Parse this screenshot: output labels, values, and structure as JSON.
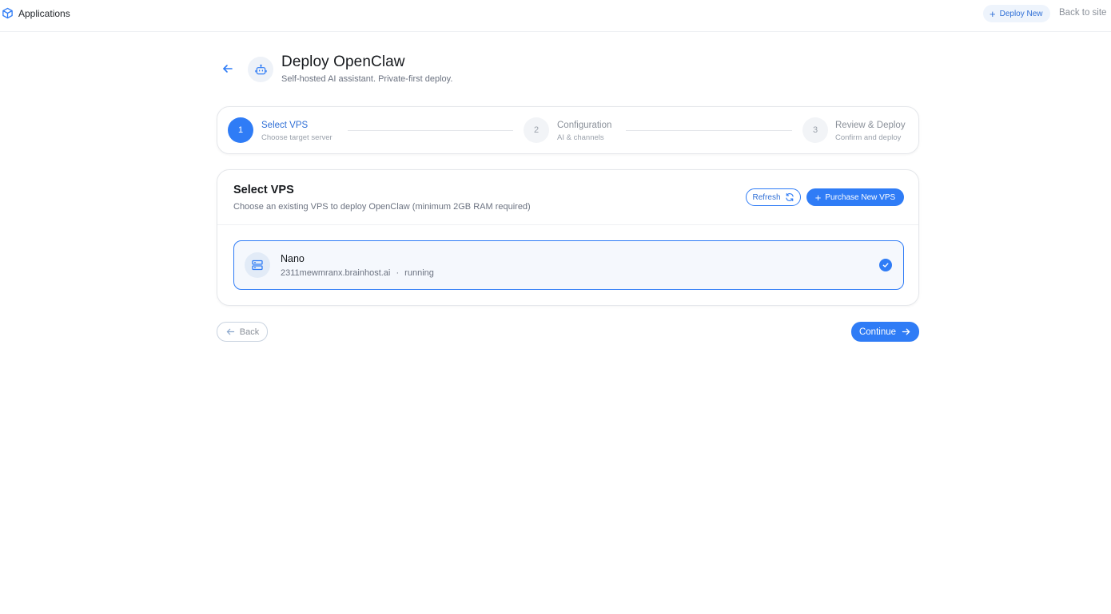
{
  "topbar": {
    "brand_icon": "cube-icon",
    "brand_label": "Applications",
    "deploy_new_label": "Deploy New",
    "back_to_site_label": "Back to site"
  },
  "header": {
    "back_icon": "arrow-left-icon",
    "app_icon": "robot-icon",
    "title": "Deploy OpenClaw",
    "subtitle": "Self-hosted AI assistant. Private-first deploy."
  },
  "stepper": {
    "steps": [
      {
        "number": "1",
        "title": "Select VPS",
        "description": "Choose target server",
        "state": "active"
      },
      {
        "number": "2",
        "title": "Configuration",
        "description": "AI & channels",
        "state": "upcoming"
      },
      {
        "number": "3",
        "title": "Review & Deploy",
        "description": "Confirm and deploy",
        "state": "upcoming"
      }
    ]
  },
  "select_vps": {
    "title": "Select VPS",
    "description": "Choose an existing VPS to deploy OpenClaw (minimum 2GB RAM required)",
    "refresh_label": "Refresh",
    "purchase_label": "Purchase New VPS",
    "servers": [
      {
        "name": "Nano",
        "host": "2311mewmranx.brainhost.ai",
        "separator": "·",
        "status": "running",
        "selected": true,
        "icon": "server-icon"
      }
    ]
  },
  "footer": {
    "back_label": "Back",
    "continue_label": "Continue"
  },
  "colors": {
    "accent": "#2f7cf6",
    "text_primary": "#16191d",
    "text_muted": "#6b7280"
  }
}
